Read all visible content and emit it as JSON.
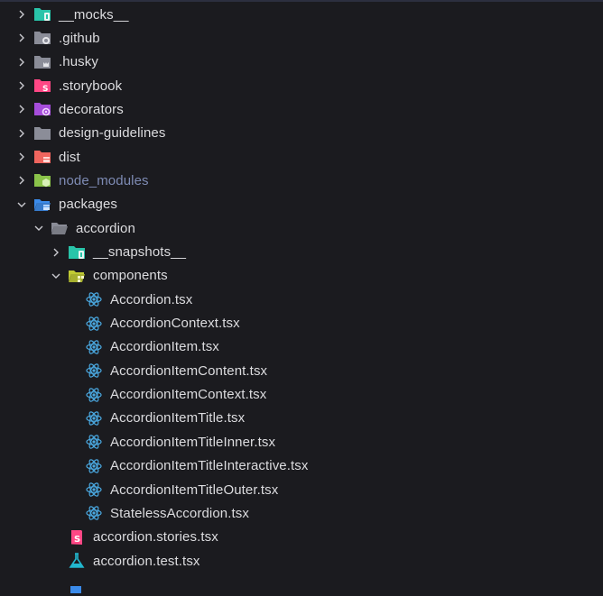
{
  "explorer": {
    "items": [
      {
        "label": "__mocks__",
        "depth": 0,
        "chevron": "right",
        "icon": "folder-mocks-icon",
        "color": "#29c4a9"
      },
      {
        "label": ".github",
        "depth": 0,
        "chevron": "right",
        "icon": "folder-github-icon",
        "color": "#8b8d98"
      },
      {
        "label": ".husky",
        "depth": 0,
        "chevron": "right",
        "icon": "folder-husky-icon",
        "color": "#8b8d98"
      },
      {
        "label": ".storybook",
        "depth": 0,
        "chevron": "right",
        "icon": "folder-storybook-icon",
        "color": "#ff4785"
      },
      {
        "label": "decorators",
        "depth": 0,
        "chevron": "right",
        "icon": "folder-decorators-icon",
        "color": "#a64ddb"
      },
      {
        "label": "design-guidelines",
        "depth": 0,
        "chevron": "right",
        "icon": "folder-icon",
        "color": "#8b8d98"
      },
      {
        "label": "dist",
        "depth": 0,
        "chevron": "right",
        "icon": "folder-dist-icon",
        "color": "#f0655e"
      },
      {
        "label": "node_modules",
        "depth": 0,
        "chevron": "right",
        "icon": "folder-node-icon",
        "color": "#8bc34a",
        "muted": true
      },
      {
        "label": "packages",
        "depth": 0,
        "chevron": "down",
        "icon": "folder-packages-open-icon",
        "color": "#3b8bea"
      },
      {
        "label": "accordion",
        "depth": 1,
        "chevron": "down",
        "icon": "folder-open-icon",
        "color": "#8b8d98"
      },
      {
        "label": "__snapshots__",
        "depth": 2,
        "chevron": "right",
        "icon": "folder-snapshots-icon",
        "color": "#29c4a9"
      },
      {
        "label": "components",
        "depth": 2,
        "chevron": "down",
        "icon": "folder-components-open-icon",
        "color": "#c0ca33"
      },
      {
        "label": "Accordion.tsx",
        "depth": 3,
        "chevron": "none",
        "icon": "react-icon",
        "color": "#4aa8e0"
      },
      {
        "label": "AccordionContext.tsx",
        "depth": 3,
        "chevron": "none",
        "icon": "react-icon",
        "color": "#4aa8e0"
      },
      {
        "label": "AccordionItem.tsx",
        "depth": 3,
        "chevron": "none",
        "icon": "react-icon",
        "color": "#4aa8e0"
      },
      {
        "label": "AccordionItemContent.tsx",
        "depth": 3,
        "chevron": "none",
        "icon": "react-icon",
        "color": "#4aa8e0"
      },
      {
        "label": "AccordionItemContext.tsx",
        "depth": 3,
        "chevron": "none",
        "icon": "react-icon",
        "color": "#4aa8e0"
      },
      {
        "label": "AccordionItemTitle.tsx",
        "depth": 3,
        "chevron": "none",
        "icon": "react-icon",
        "color": "#4aa8e0"
      },
      {
        "label": "AccordionItemTitleInner.tsx",
        "depth": 3,
        "chevron": "none",
        "icon": "react-icon",
        "color": "#4aa8e0"
      },
      {
        "label": "AccordionItemTitleInteractive.tsx",
        "depth": 3,
        "chevron": "none",
        "icon": "react-icon",
        "color": "#4aa8e0"
      },
      {
        "label": "AccordionItemTitleOuter.tsx",
        "depth": 3,
        "chevron": "none",
        "icon": "react-icon",
        "color": "#4aa8e0"
      },
      {
        "label": "StatelessAccordion.tsx",
        "depth": 3,
        "chevron": "none",
        "icon": "react-icon",
        "color": "#4aa8e0"
      },
      {
        "label": "accordion.stories.tsx",
        "depth": 2,
        "chevron": "none",
        "icon": "storybook-file-icon",
        "color": "#ff4785"
      },
      {
        "label": "accordion.test.tsx",
        "depth": 2,
        "chevron": "none",
        "icon": "test-flask-icon",
        "color": "#22b8cf"
      },
      {
        "label": "",
        "depth": 2,
        "chevron": "none",
        "icon": "file-partial-icon",
        "color": "#3b8bea"
      }
    ]
  }
}
